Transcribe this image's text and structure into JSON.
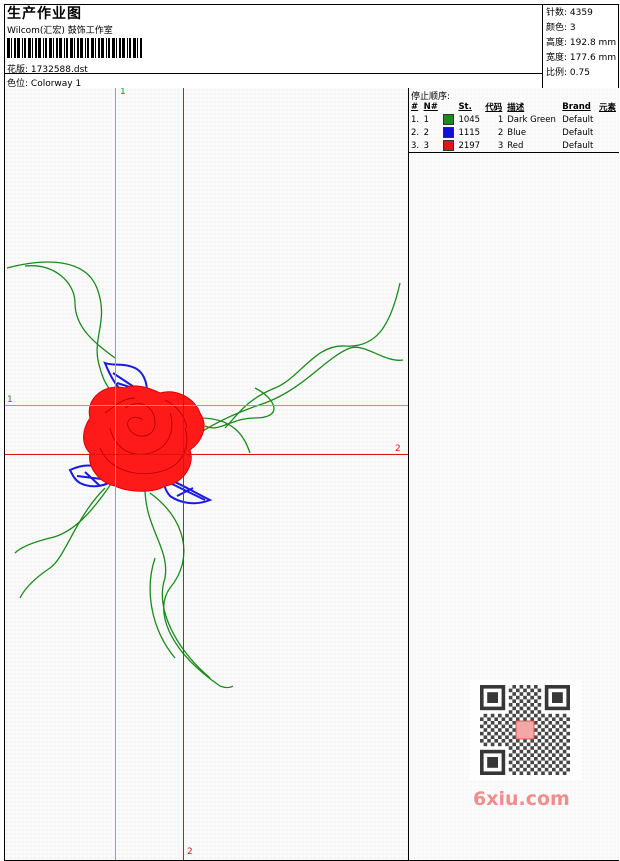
{
  "header": {
    "title": "生产作业图",
    "company": "Wilcom(汇宏) 鼓饰工作室",
    "design_label": "花版:",
    "design_value": "1732588.dst",
    "colorway_label": "色位:",
    "colorway_value": "Colorway 1"
  },
  "stats": [
    {
      "label": "针数:",
      "value": "4359"
    },
    {
      "label": "颜色:",
      "value": "3"
    },
    {
      "label": "高度:",
      "value": "192.8 mm"
    },
    {
      "label": "宽度:",
      "value": "177.6 mm"
    },
    {
      "label": "比例:",
      "value": "0.75"
    }
  ],
  "stop_sequence": {
    "title": "停止顺序:",
    "columns": [
      "#",
      "N#",
      "St.",
      "代码",
      "描述",
      "Brand",
      "元素"
    ],
    "rows": [
      {
        "index": "1.",
        "n": "1",
        "color": "#1a8a1a",
        "stitches": "1045",
        "code": "1",
        "description": "Dark Green",
        "brand": "Default"
      },
      {
        "index": "2.",
        "n": "2",
        "color": "#1010d8",
        "stitches": "1115",
        "code": "2",
        "description": "Blue",
        "brand": "Default"
      },
      {
        "index": "3.",
        "n": "3",
        "color": "#e81010",
        "stitches": "2197",
        "code": "3",
        "description": "Red",
        "brand": "Default"
      }
    ]
  },
  "guides": {
    "green_label_top": "1",
    "green_label_left": "1",
    "red_label_right": "2",
    "red_label_bottom": "2"
  },
  "design_colors": {
    "green": "#1a8a1a",
    "blue": "#1a1ae0",
    "red": "#ff1a1a",
    "guide_green": "#44dd44",
    "guide_red": "#e01010"
  },
  "watermark": {
    "text": "6xiu.com"
  }
}
